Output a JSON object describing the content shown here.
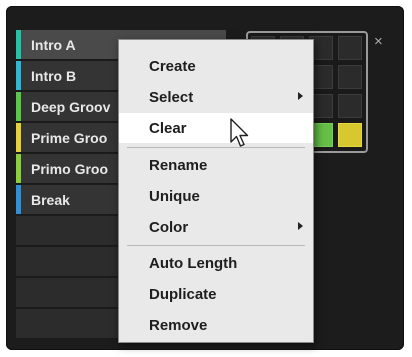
{
  "scenes": [
    {
      "name": "Intro A",
      "color": "#22c3a8",
      "selected": true
    },
    {
      "name": "Intro B",
      "color": "#2fb7d8"
    },
    {
      "name": "Deep Groov",
      "color": "#58c848"
    },
    {
      "name": "Prime Groo",
      "color": "#e8d038"
    },
    {
      "name": "Primo Groo",
      "color": "#8ad038"
    },
    {
      "name": "Break",
      "color": "#2f8fd8"
    }
  ],
  "close_symbol": "×",
  "context_menu": {
    "items": [
      {
        "label": "Create"
      },
      {
        "label": "Select",
        "has_submenu": true
      },
      {
        "label": "Clear",
        "hovered": true
      },
      {
        "label": "Rename"
      },
      {
        "label": "Unique"
      },
      {
        "label": "Color",
        "has_submenu": true
      },
      {
        "label": "Auto Length"
      },
      {
        "label": "Duplicate"
      },
      {
        "label": "Remove"
      }
    ]
  },
  "pad_colors": {
    "green": "#66bf46",
    "yellow": "#d8c830"
  },
  "icons": {
    "cursor": "mouse-pointer-icon",
    "close": "close-icon",
    "submenu": "submenu-arrow-icon"
  }
}
